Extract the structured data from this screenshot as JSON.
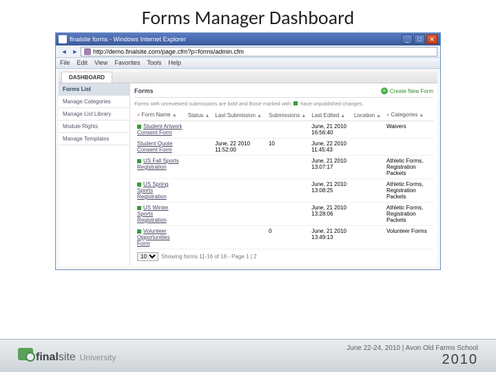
{
  "slide_title": "Forms Manager Dashboard",
  "browser": {
    "title": "finalsite forms - Windows Internet Explorer",
    "url": "http://demo.finalsite.com/page.cfm?p=forms/admin.cfm",
    "menus": [
      "File",
      "Edit",
      "View",
      "Favorites",
      "Tools",
      "Help"
    ]
  },
  "tab": "DASHBOARD",
  "sidebar": {
    "items": [
      {
        "label": "Forms List",
        "active": true
      },
      {
        "label": "Manage Categories",
        "active": false
      },
      {
        "label": "Manage List Library",
        "active": false
      },
      {
        "label": "Module Rights",
        "active": false
      },
      {
        "label": "Manage Templates",
        "active": false
      }
    ]
  },
  "panel": {
    "title": "Forms",
    "create_label": "Create New Form",
    "hint_prefix": "Forms with unreviewed submissions are bold and those marked with",
    "hint_suffix": "have unpublished changes.",
    "columns": [
      "Form Name",
      "Status",
      "Last Submission",
      "Submissions",
      "Last Edited",
      "Location",
      "Categories"
    ],
    "rows": [
      {
        "name": "Student Artwork Consent Form",
        "flag": true,
        "last_sub": "",
        "subs": "",
        "edited": "June, 21 2010 16:56:40",
        "loc": "",
        "cats": "Waivers"
      },
      {
        "name": "Student Quote Consent Form",
        "flag": false,
        "last_sub": "June, 22 2010 11:52:00",
        "subs": "10",
        "edited": "June, 22 2010 11:45:43",
        "loc": "",
        "cats": ""
      },
      {
        "name": "US Fall Sports Registration",
        "flag": true,
        "last_sub": "",
        "subs": "",
        "edited": "June, 21 2010 13:07:17",
        "loc": "",
        "cats": "Athletic Forms, Registration Packets"
      },
      {
        "name": "US Spring Sports Registration",
        "flag": true,
        "last_sub": "",
        "subs": "",
        "edited": "June, 21 2010 13:08:25",
        "loc": "",
        "cats": "Athletic Forms, Registration Packets"
      },
      {
        "name": "US Winter Sports Registration",
        "flag": true,
        "last_sub": "",
        "subs": "",
        "edited": "June, 21 2010 13:28:06",
        "loc": "",
        "cats": "Athletic Forms, Registration Packets"
      },
      {
        "name": "Volunteer Opportunities Form",
        "flag": true,
        "last_sub": "",
        "subs": "0",
        "edited": "June, 21 2010 13:49:13",
        "loc": "",
        "cats": "Volunteer Forms"
      }
    ],
    "pager": {
      "size": "10",
      "text": "Showing forms 11-16 of 16 - Page 1 | 2"
    }
  },
  "footer": {
    "brand1": "final",
    "brand2": "site",
    "brand3": "University",
    "date": "June 22-24, 2010 | Avon Old Farms School",
    "year": "2010"
  }
}
